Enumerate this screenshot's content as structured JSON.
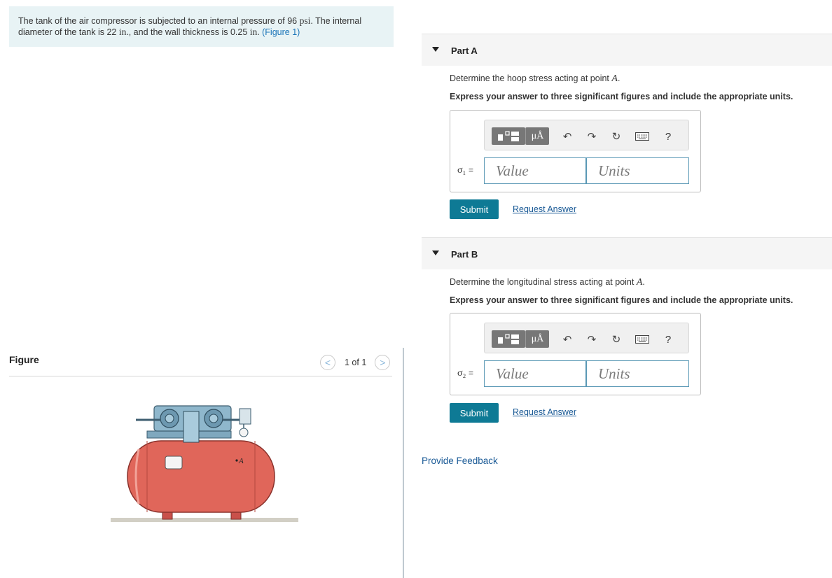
{
  "problem": {
    "t1": "The tank of the air compressor is subjected to an internal pressure of 96 ",
    "u1": "psi",
    "t2": ". The internal",
    "t3": "diameter of the tank is 22 ",
    "u2": "in.",
    "t4": ", and the wall thickness is 0.25 ",
    "u3": "in.",
    "t5": " ",
    "figure_link": "(Figure 1)"
  },
  "figure": {
    "title": "Figure",
    "pager": "1 of 1",
    "prev_glyph": "<",
    "next_glyph": ">",
    "point_label": "A"
  },
  "parts": [
    {
      "title": "Part A",
      "q_text": "Determine the hoop stress acting at point ",
      "q_var": "A",
      "q_end": ".",
      "instruction": "Express your answer to three significant figures and include the appropriate units.",
      "sigma": "σ₁",
      "eq": "=",
      "value_placeholder": "Value",
      "units_placeholder": "Units",
      "submit": "Submit",
      "request": "Request Answer"
    },
    {
      "title": "Part B",
      "q_text": "Determine the longitudinal stress acting at point ",
      "q_var": "A",
      "q_end": ".",
      "instruction": "Express your answer to three significant figures and include the appropriate units.",
      "sigma": "σ₂",
      "eq": "=",
      "value_placeholder": "Value",
      "units_placeholder": "Units",
      "submit": "Submit",
      "request": "Request Answer"
    }
  ],
  "toolbar": {
    "mu_label": "μÅ",
    "undo": "↶",
    "redo": "↷",
    "reset": "↻",
    "help": "?"
  },
  "feedback": "Provide Feedback"
}
